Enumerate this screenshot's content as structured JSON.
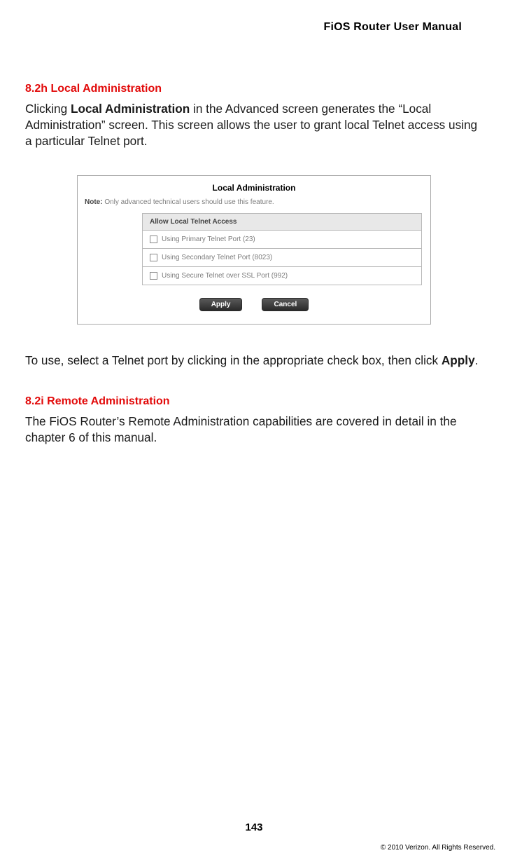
{
  "header": {
    "title": "FiOS Router User Manual"
  },
  "section1": {
    "heading": "8.2h  Local Administration",
    "para_pre": "Clicking ",
    "para_bold": "Local Administration",
    "para_post": " in the Advanced screen generates the “Local Administration” screen. This screen allows the user to grant local Telnet access using a particular Telnet port."
  },
  "figure": {
    "title": "Local Administration",
    "note_label": "Note:",
    "note_text": " Only advanced technical users should use this feature.",
    "table_header": "Allow Local Telnet Access",
    "options": [
      "Using Primary Telnet Port (23)",
      "Using Secondary Telnet Port (8023)",
      "Using Secure Telnet over SSL Port (992)"
    ],
    "apply_label": "Apply",
    "cancel_label": "Cancel"
  },
  "section1b": {
    "para2_pre": "To use, select a Telnet port by clicking in the appropriate check box, then click ",
    "para2_bold": "Apply",
    "para2_post": "."
  },
  "section2": {
    "heading": "8.2i  Remote Administration",
    "para": "The FiOS Router’s Remote Administration capabilities are covered in detail in the chapter 6 of this manual."
  },
  "footer": {
    "page_number": "143",
    "copyright": "© 2010 Verizon. All Rights Reserved."
  }
}
